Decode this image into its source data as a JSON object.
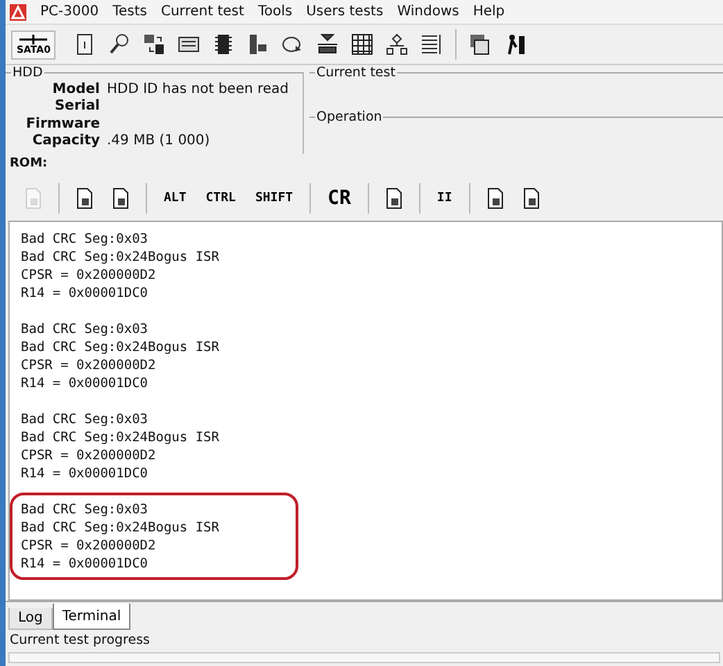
{
  "window": {
    "title": "PC-3000"
  },
  "menu": [
    "Tests",
    "Current test",
    "Tools",
    "Users tests",
    "Windows",
    "Help"
  ],
  "port_button": {
    "label": "SATA0"
  },
  "hdd": {
    "title": "HDD",
    "fields": [
      {
        "label": "Model",
        "value": "HDD ID has not been read"
      },
      {
        "label": "Serial"
      },
      {
        "label": "Firmware"
      },
      {
        "label": "Capacity",
        "value": ".49 MB (1 000)"
      }
    ]
  },
  "current_test": {
    "title": "Current test"
  },
  "operation": {
    "title": "Operation"
  },
  "rom_label": "ROM:",
  "terminal_toolbar": [
    {
      "kind": "icon",
      "disabled": true
    },
    {
      "kind": "sep"
    },
    {
      "kind": "icon",
      "disabled": false
    },
    {
      "kind": "icon",
      "disabled": false
    },
    {
      "kind": "sep"
    },
    {
      "kind": "key",
      "label": "ALT"
    },
    {
      "kind": "key",
      "label": "CTRL"
    },
    {
      "kind": "key",
      "label": "SHIFT"
    },
    {
      "kind": "sep"
    },
    {
      "kind": "key",
      "label": "CR",
      "big": true
    },
    {
      "kind": "sep"
    },
    {
      "kind": "icon",
      "disabled": false
    },
    {
      "kind": "sep"
    },
    {
      "kind": "key",
      "label": "II"
    },
    {
      "kind": "sep"
    },
    {
      "kind": "icon",
      "disabled": false
    },
    {
      "kind": "icon",
      "disabled": false
    }
  ],
  "terminal_blocks": [
    {
      "highlighted": false,
      "lines": [
        "Bad CRC Seg:0x03",
        "Bad CRC Seg:0x24Bogus ISR",
        "CPSR = 0x200000D2",
        "R14 = 0x00001DC0"
      ]
    },
    {
      "highlighted": false,
      "lines": [
        "Bad CRC Seg:0x03",
        "Bad CRC Seg:0x24Bogus ISR",
        "CPSR = 0x200000D2",
        "R14 = 0x00001DC0"
      ]
    },
    {
      "highlighted": false,
      "lines": [
        "Bad CRC Seg:0x03",
        "Bad CRC Seg:0x24Bogus ISR",
        "CPSR = 0x200000D2",
        "R14 = 0x00001DC0"
      ]
    },
    {
      "highlighted": true,
      "lines": [
        "Bad CRC Seg:0x03",
        "Bad CRC Seg:0x24Bogus ISR",
        "CPSR = 0x200000D2",
        "R14 = 0x00001DC0"
      ]
    }
  ],
  "tabs": [
    {
      "label": "Log",
      "selected": false
    },
    {
      "label": "Terminal",
      "selected": true
    }
  ],
  "status_bar": {
    "label": "Current test progress",
    "progress": {
      "level": 0
    }
  }
}
